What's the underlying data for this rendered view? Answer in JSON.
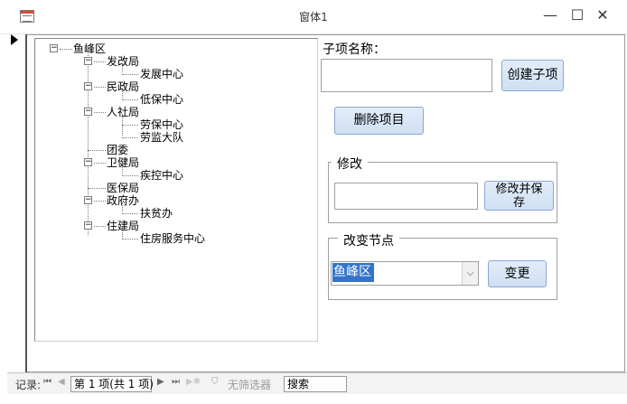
{
  "window": {
    "title": "窗体1",
    "minimize": "—",
    "maximize": "☐",
    "close": "✕"
  },
  "tree": {
    "nodes": [
      {
        "label": "鱼峰区",
        "level": 0,
        "expanded": true
      },
      {
        "label": "发改局",
        "level": 1,
        "expanded": true
      },
      {
        "label": "发展中心",
        "level": 2
      },
      {
        "label": "民政局",
        "level": 1,
        "expanded": true
      },
      {
        "label": "低保中心",
        "level": 2
      },
      {
        "label": "人社局",
        "level": 1,
        "expanded": true
      },
      {
        "label": "劳保中心",
        "level": 2
      },
      {
        "label": "劳监大队",
        "level": 2
      },
      {
        "label": "团委",
        "level": 1
      },
      {
        "label": "卫健局",
        "level": 1,
        "expanded": true
      },
      {
        "label": "疾控中心",
        "level": 2
      },
      {
        "label": "医保局",
        "level": 1
      },
      {
        "label": "政府办",
        "level": 1,
        "expanded": true
      },
      {
        "label": "扶贫办",
        "level": 2
      },
      {
        "label": "住建局",
        "level": 1,
        "expanded": true
      },
      {
        "label": "住房服务中心",
        "level": 2
      }
    ]
  },
  "form": {
    "child_name_label": "子项名称：",
    "child_name_value": "",
    "create_child_button": "创建子项",
    "delete_item_button": "删除项目",
    "modify_group_title": "修改",
    "modify_value": "",
    "modify_save_button_line1": "修改并保",
    "modify_save_button_line2": "存",
    "change_node_group_title": "改变节点",
    "change_node_selected": "鱼峰区",
    "change_button": "变更"
  },
  "navigation": {
    "record_label": "记录:",
    "record_position": "第 1 项(共 1 项)",
    "no_filter_label": "无筛选器",
    "search_label": "搜索"
  }
}
